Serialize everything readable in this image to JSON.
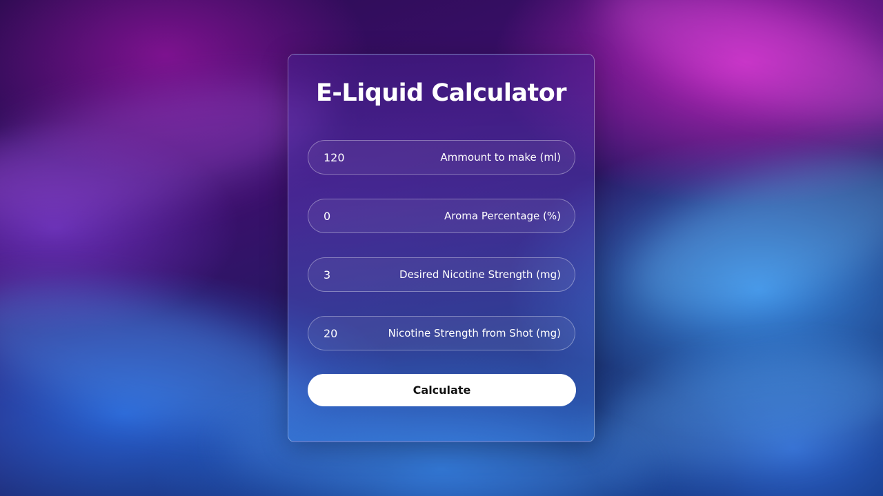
{
  "calculator": {
    "title": "E-Liquid Calculator",
    "fields": [
      {
        "value": "120",
        "label": "Ammount to make (ml)"
      },
      {
        "value": "0",
        "label": "Aroma Percentage (%)"
      },
      {
        "value": "3",
        "label": "Desired Nicotine Strength (mg)"
      },
      {
        "value": "20",
        "label": "Nicotine Strength from Shot (mg)"
      }
    ],
    "calculate_label": "Calculate"
  },
  "colors": {
    "card_border": "#ffffff",
    "button_bg": "#ffffff",
    "button_text": "#111111",
    "text": "#ffffff",
    "background_primary": "#3a0f6b",
    "background_secondary": "#0d2a6e"
  }
}
